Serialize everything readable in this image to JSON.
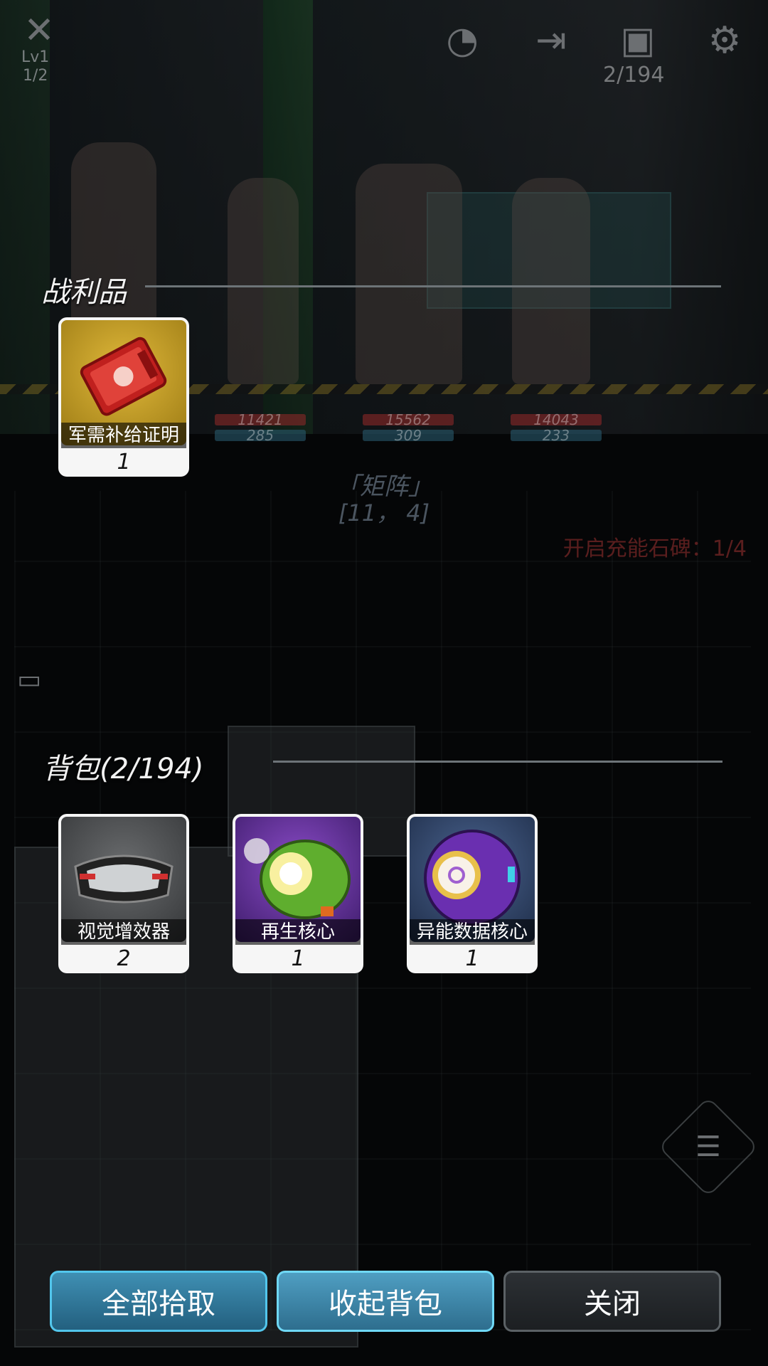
{
  "hud": {
    "level_label": "Lv1",
    "level_progress": "1/2",
    "bag_count": "2/194",
    "icons": [
      "skill-icon",
      "radar-icon",
      "exit-door-icon",
      "bag-icon",
      "settings-gear-icon"
    ]
  },
  "scene": {
    "party_stats": [
      {
        "hp": "11421",
        "mp": "285"
      },
      {
        "hp": "15562",
        "mp": "309"
      },
      {
        "hp": "14043",
        "mp": "233"
      }
    ],
    "zone_name": "「矩阵」",
    "zone_coords": "[11， 4]",
    "charge_status": "开启充能石碑：1/4"
  },
  "loot": {
    "title": "战利品",
    "items": [
      {
        "name": "军需补给证明",
        "qty": "1",
        "icon": "supply-certificate-icon",
        "rarity": "gold"
      }
    ]
  },
  "backpack": {
    "title": "背包(2/194)",
    "items": [
      {
        "name": "视觉增效器",
        "qty": "2",
        "icon": "visor-goggles-icon",
        "rarity": "grey"
      },
      {
        "name": "再生核心",
        "qty": "1",
        "icon": "regen-core-icon",
        "rarity": "purple"
      },
      {
        "name": "异能数据核心",
        "qty": "1",
        "icon": "psionic-data-core-icon",
        "rarity": "blue"
      }
    ]
  },
  "buttons": {
    "pick_all": "全部拾取",
    "collapse_bag": "收起背包",
    "close": "关闭"
  },
  "colors": {
    "accent_blue": "#52c6ec",
    "gold_rarity": "#e0b83a",
    "purple_rarity": "#8b4cc8",
    "blue_rarity": "#4b6490"
  }
}
